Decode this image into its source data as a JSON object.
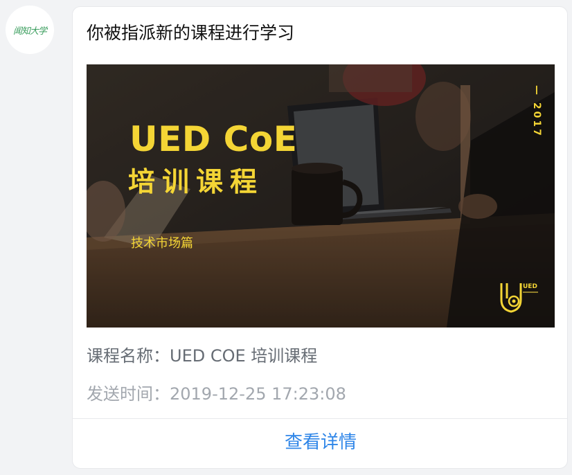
{
  "sender": {
    "avatar_text": "闻知大学"
  },
  "message": {
    "title": "你被指派新的课程进行学习",
    "banner": {
      "heading": "UED CoE",
      "subheading": "培训课程",
      "tag": "技术市场篇",
      "year": "— 2017",
      "logo_text": "UED"
    },
    "course_name_label": "课程名称：",
    "course_name_value": "UED COE 培训课程",
    "send_time_label": "发送时间：",
    "send_time_value": "2019-12-25 17:23:08",
    "detail_button": "查看详情"
  },
  "colors": {
    "accent": "#2f86e8",
    "banner_text": "#f4d535"
  }
}
